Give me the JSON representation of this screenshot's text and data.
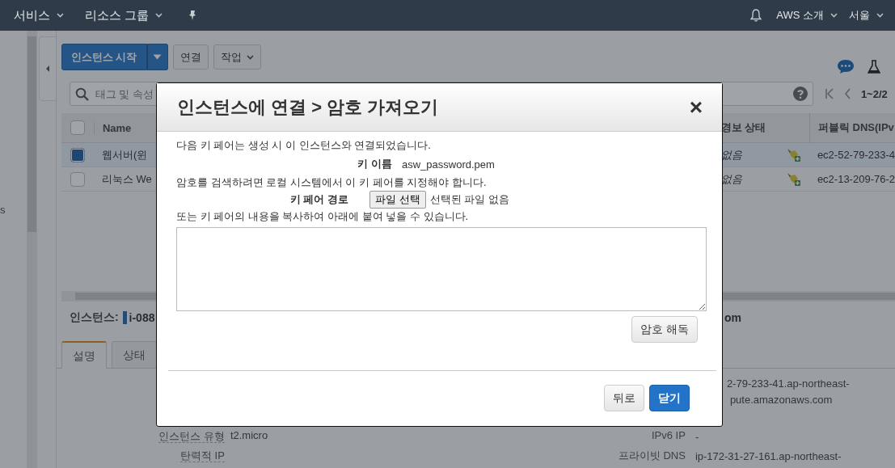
{
  "top_nav": {
    "left": [
      {
        "label": "서비스",
        "dropdown": true
      },
      {
        "label": "리소스 그룹",
        "dropdown": true
      }
    ],
    "right": [
      {
        "label": "AWS 소개",
        "dropdown": true
      },
      {
        "label": "서울",
        "dropdown": true
      }
    ]
  },
  "side_nav": {
    "text": "s"
  },
  "toolbar": {
    "launch_button": "인스턴스 시작",
    "buttons": [
      {
        "label": "연결",
        "dropdown": false
      },
      {
        "label": "작업",
        "dropdown": true
      }
    ]
  },
  "search": {
    "placeholder": "태그 및 속성"
  },
  "pagination": {
    "range": "1~2/2"
  },
  "table": {
    "header_checked": false,
    "columns": [
      "Name",
      "경보 상태",
      "퍼블릭 DNS(IPv"
    ],
    "rows": [
      {
        "selected": true,
        "name": "웹서버(윈",
        "alarm_status": "없음",
        "public_dns": "ec2-52-79-233-4"
      },
      {
        "selected": false,
        "name": "리눅스 We",
        "alarm_status": "없음",
        "public_dns": "ec2-13-209-76-2"
      }
    ]
  },
  "details": {
    "instance_label": "인스턴스:",
    "instance_id": "i-088",
    "trailing": "om",
    "tabs": [
      {
        "label": "설명",
        "selected": true
      },
      {
        "label": "상태",
        "selected": false
      }
    ],
    "rows": [
      {
        "right_lines": [
          "2-79-233-41.ap-northeast-",
          "pute.amazonaws.com"
        ]
      },
      {
        "left_label": "인스턴스 유형",
        "left_value": "t2.micro",
        "right_label": "IPv6 IP",
        "right_value": "-"
      },
      {
        "left_label": "탄력적 IP",
        "right_label": "프라이빗 DNS",
        "right_value": "ip-172-31-27-161.ap-northeast-"
      }
    ]
  },
  "modal": {
    "title": "인스턴스에 연결 > 암호 가져오기",
    "close": "×",
    "intro": "다음 키 페어는 생성 시 이 인스턴스와 연결되었습니다.",
    "key_name": {
      "label": "키 이름",
      "value": "asw_password.pem"
    },
    "instruction": "암호를 검색하려면 로컬 시스템에서 이 키 페어를 지정해야 합니다.",
    "key_path": {
      "label": "키 페어 경로",
      "button": "파일 선택",
      "status": "선택된 파일 없음"
    },
    "paste_hint": "또는 키 페어의 내용을 복사하여 아래에 붙여 넣을 수 있습니다.",
    "decrypt_button": "암호 해독",
    "footer_buttons": [
      {
        "label": "뒤로",
        "primary": false
      },
      {
        "label": "닫기",
        "primary": true
      }
    ]
  }
}
